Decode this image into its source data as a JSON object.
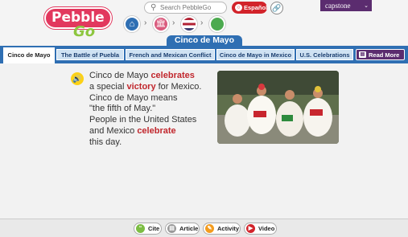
{
  "header": {
    "logo_top": "Pebble",
    "logo_bottom": "Go",
    "search_placeholder": "Search PebbleGo",
    "espanol_label": "Español",
    "capstone_label": "capstone",
    "crumb_icons": [
      "home-icon",
      "government-building-icon",
      "us-flag-icon",
      "mexico-icon"
    ]
  },
  "topic": {
    "title": "Cinco de Mayo"
  },
  "tabs": [
    {
      "label": "Cinco de Mayo",
      "active": true
    },
    {
      "label": "The Battle of Puebla",
      "active": false
    },
    {
      "label": "French and Mexican Conflict",
      "active": false
    },
    {
      "label": "Cinco de Mayo in Mexico",
      "active": false
    },
    {
      "label": "U.S. Celebrations",
      "active": false
    }
  ],
  "read_more_label": "Read More",
  "article": {
    "segments": [
      {
        "t": "Cinco de Mayo ",
        "h": false
      },
      {
        "t": "celebrates",
        "h": true
      },
      {
        "t": "\na special ",
        "h": false
      },
      {
        "t": "victory",
        "h": true
      },
      {
        "t": " for Mexico.",
        "h": false
      },
      {
        "t": "\nCinco de Mayo means",
        "h": false
      },
      {
        "t": "\n\"the fifth of May.\"",
        "h": false
      },
      {
        "t": "\nPeople in the United States",
        "h": false
      },
      {
        "t": "\nand Mexico ",
        "h": false
      },
      {
        "t": "celebrate",
        "h": true
      },
      {
        "t": "\nthis day.",
        "h": false
      }
    ]
  },
  "footer": {
    "cite_label": "Cite",
    "article_label": "Article",
    "activity_label": "Activity",
    "video_label": "Video"
  },
  "colors": {
    "brand_blue": "#2f6fb3",
    "highlight_red": "#c1272d",
    "capstone_purple": "#5b2c6f",
    "logo_pink": "#e2385e",
    "logo_green": "#8dc63f"
  }
}
